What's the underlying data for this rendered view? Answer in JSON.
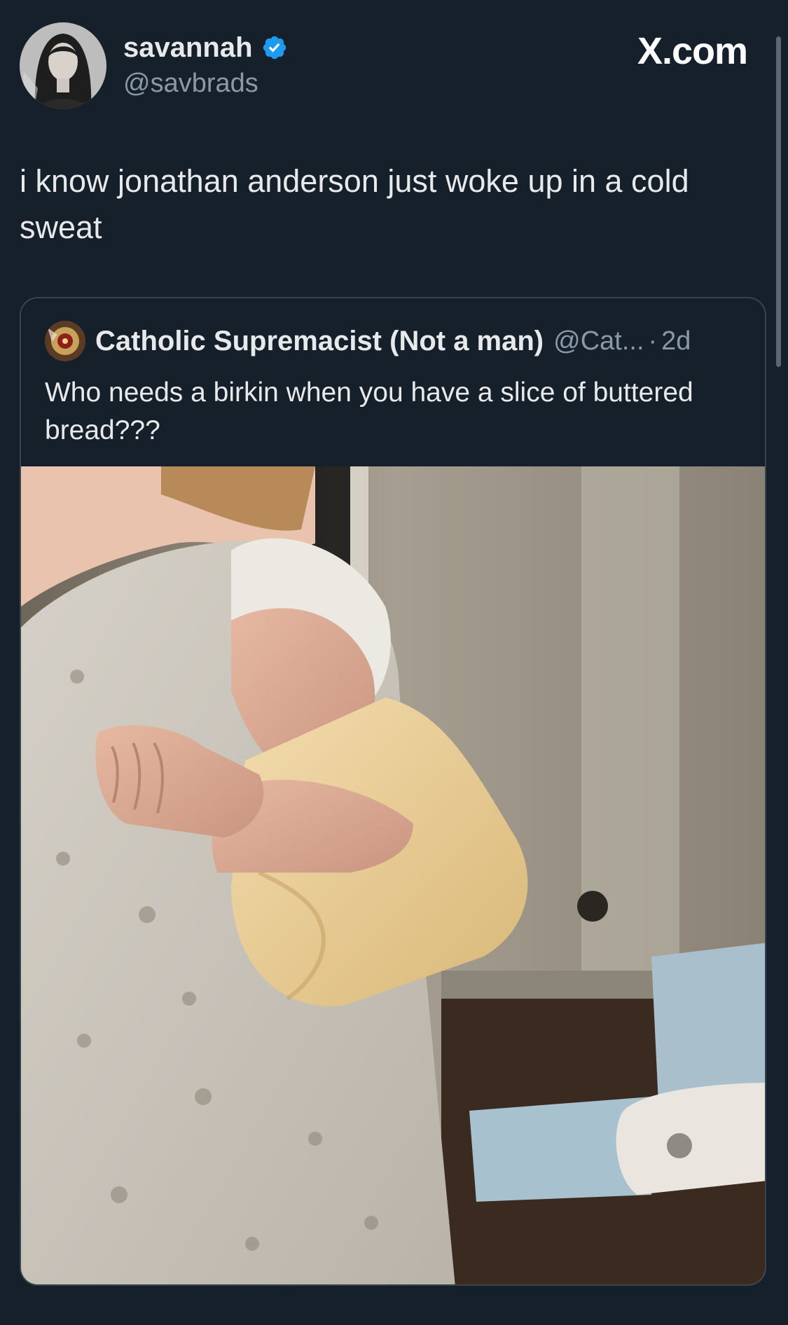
{
  "tweet": {
    "author": {
      "display_name": "savannah",
      "handle": "@savbrads",
      "verified": true
    },
    "brand": "X.com",
    "text": "i know jonathan anderson just woke up in a cold sweat",
    "quoted_tweet": {
      "author_name": "Catholic Supremacist (Not a man)",
      "author_handle": "@Cat...",
      "separator": "·",
      "timestamp": "2d",
      "text": "Who needs a birkin when you have a slice of buttered bread???"
    }
  },
  "icons": {
    "verified": "verified-badge-icon"
  },
  "colors": {
    "background": "#15202b",
    "text": "#e7e9ea",
    "muted": "#8b98a5",
    "verified": "#1d9bf0",
    "border": "#38444d"
  }
}
